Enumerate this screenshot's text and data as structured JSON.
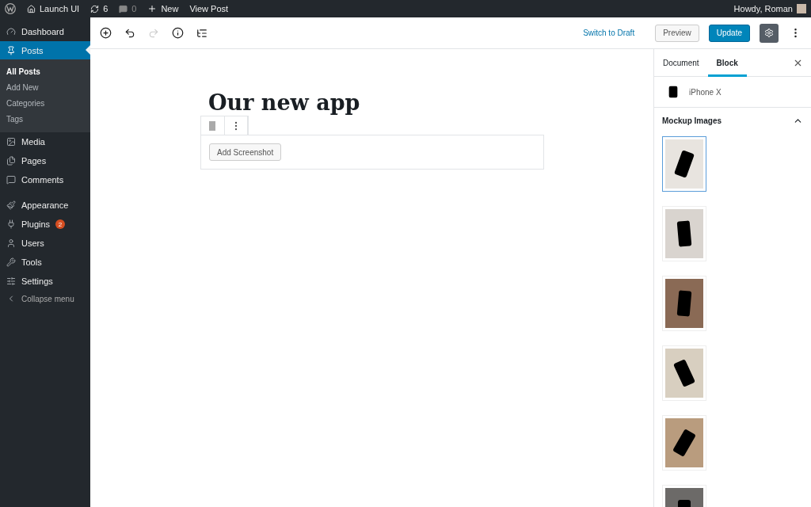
{
  "admin_bar": {
    "site": "Launch UI",
    "updates": "6",
    "comments": "0",
    "new": "New",
    "view_post": "View Post",
    "greeting": "Howdy, Roman"
  },
  "sidebar": {
    "items": [
      {
        "kind": "dashboard",
        "label": "Dashboard",
        "selected": false
      },
      {
        "kind": "posts",
        "label": "Posts",
        "selected": true,
        "children": [
          {
            "label": "All Posts",
            "selected": true
          },
          {
            "label": "Add New",
            "selected": false
          },
          {
            "label": "Categories",
            "selected": false
          },
          {
            "label": "Tags",
            "selected": false
          }
        ]
      },
      {
        "kind": "media",
        "label": "Media",
        "selected": false
      },
      {
        "kind": "pages",
        "label": "Pages",
        "selected": false
      },
      {
        "kind": "comments",
        "label": "Comments",
        "selected": false
      },
      {
        "kind": "appearance",
        "label": "Appearance",
        "selected": false
      },
      {
        "kind": "plugins",
        "label": "Plugins",
        "selected": false,
        "badge": "2"
      },
      {
        "kind": "users",
        "label": "Users",
        "selected": false
      },
      {
        "kind": "tools",
        "label": "Tools",
        "selected": false
      },
      {
        "kind": "settings",
        "label": "Settings",
        "selected": false
      }
    ],
    "collapse": "Collapse menu"
  },
  "toolbar": {
    "switch_to_draft": "Switch to Draft",
    "preview": "Preview",
    "update": "Update"
  },
  "post": {
    "title": "Our new app",
    "add_button": "Add Screenshot"
  },
  "settings_panel": {
    "tabs": [
      {
        "label": "Document",
        "selected": false
      },
      {
        "label": "Block",
        "selected": true
      }
    ],
    "block_name": "iPhone X",
    "section": {
      "title": "Mockup Images",
      "expanded": true,
      "images": [
        {
          "selected": true
        },
        {
          "selected": false
        },
        {
          "selected": false
        },
        {
          "selected": false
        },
        {
          "selected": false
        },
        {
          "selected": false
        }
      ]
    }
  }
}
